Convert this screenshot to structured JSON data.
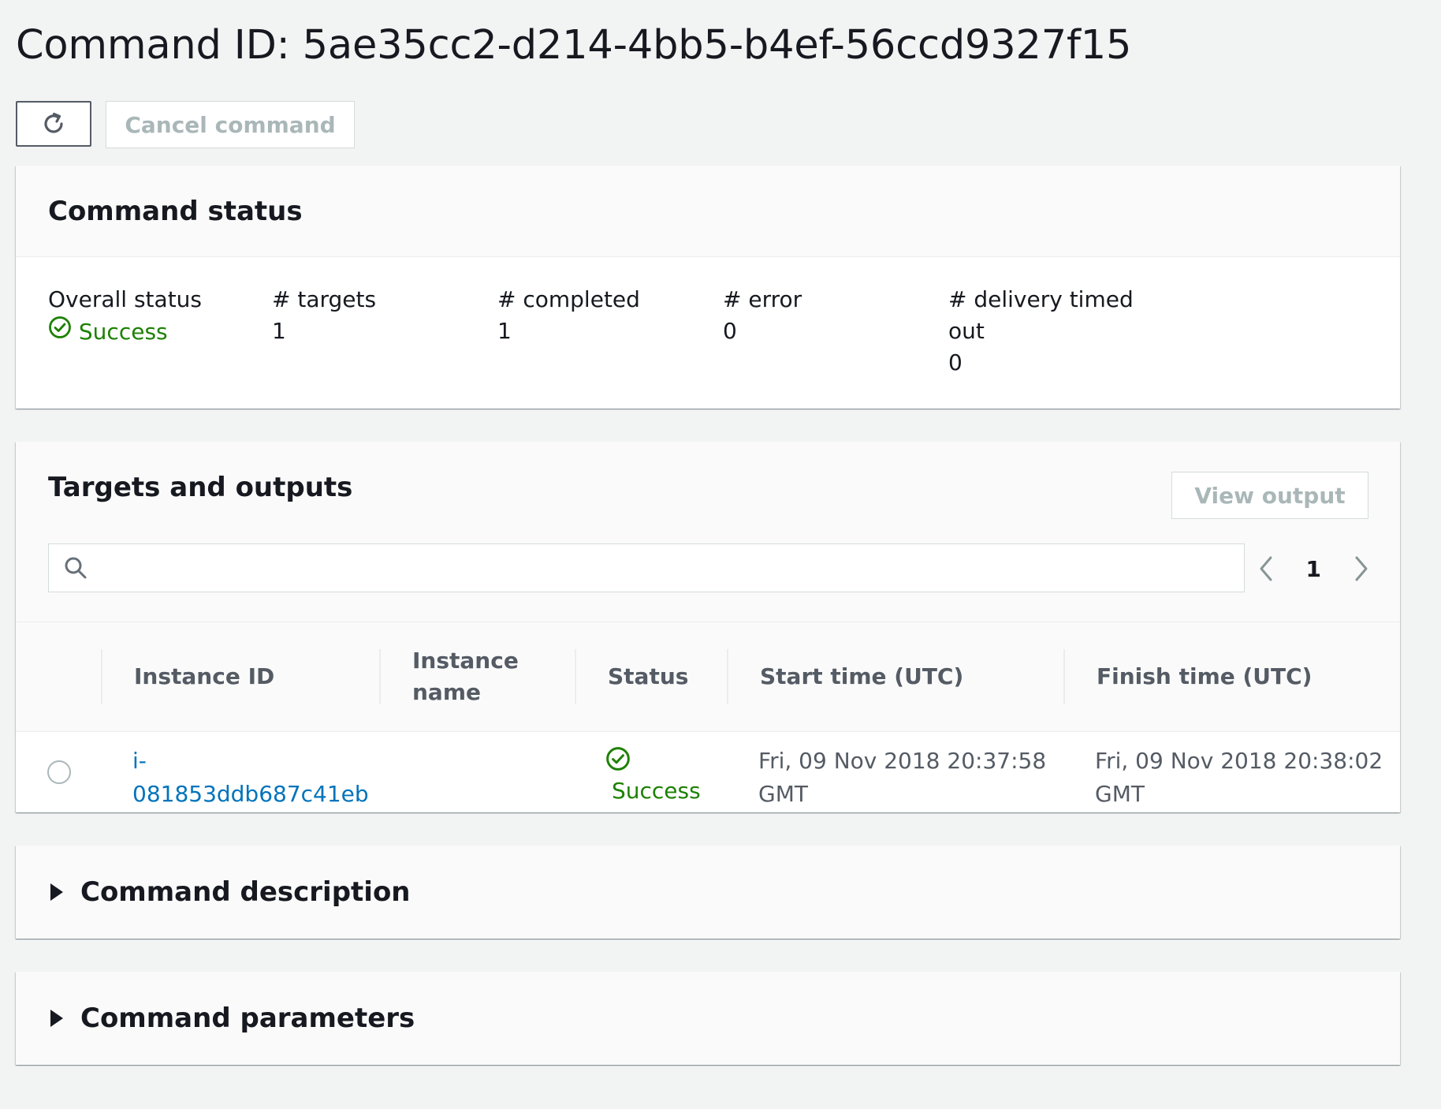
{
  "page": {
    "title": "Command ID: 5ae35cc2-d214-4bb5-b4ef-56ccd9327f15"
  },
  "toolbar": {
    "refresh_icon": "refresh-icon",
    "cancel_label": "Cancel command"
  },
  "command_status": {
    "title": "Command status",
    "overall_status_label": "Overall status",
    "overall_status_value": "Success",
    "targets_label": "# targets",
    "targets_value": "1",
    "completed_label": "# completed",
    "completed_value": "1",
    "error_label": "# error",
    "error_value": "0",
    "delivery_timed_out_label_line1": "# delivery timed",
    "delivery_timed_out_label_line2": "out",
    "delivery_timed_out_value": "0"
  },
  "targets": {
    "title": "Targets and outputs",
    "view_output_label": "View output",
    "search_placeholder": "",
    "page_number": "1",
    "columns": {
      "instance_id": "Instance ID",
      "instance_name_line1": "Instance",
      "instance_name_line2": "name",
      "status": "Status",
      "start_time": "Start time (UTC)",
      "finish_time": "Finish time (UTC)"
    },
    "rows": [
      {
        "instance_id_line1": "i-",
        "instance_id_line2": "081853ddb687c41eb",
        "instance_name": "",
        "status": "Success",
        "start_time_line1": "Fri, 09 Nov 2018 20:37:58",
        "start_time_line2": "GMT",
        "finish_time_line1": "Fri, 09 Nov 2018 20:38:02",
        "finish_time_line2": "GMT"
      }
    ]
  },
  "sections": {
    "description_title": "Command description",
    "parameters_title": "Command parameters"
  },
  "colors": {
    "success": "#1d8102",
    "link": "#0073bb",
    "disabled_text": "#aab7b8",
    "background": "#f2f3f3"
  }
}
